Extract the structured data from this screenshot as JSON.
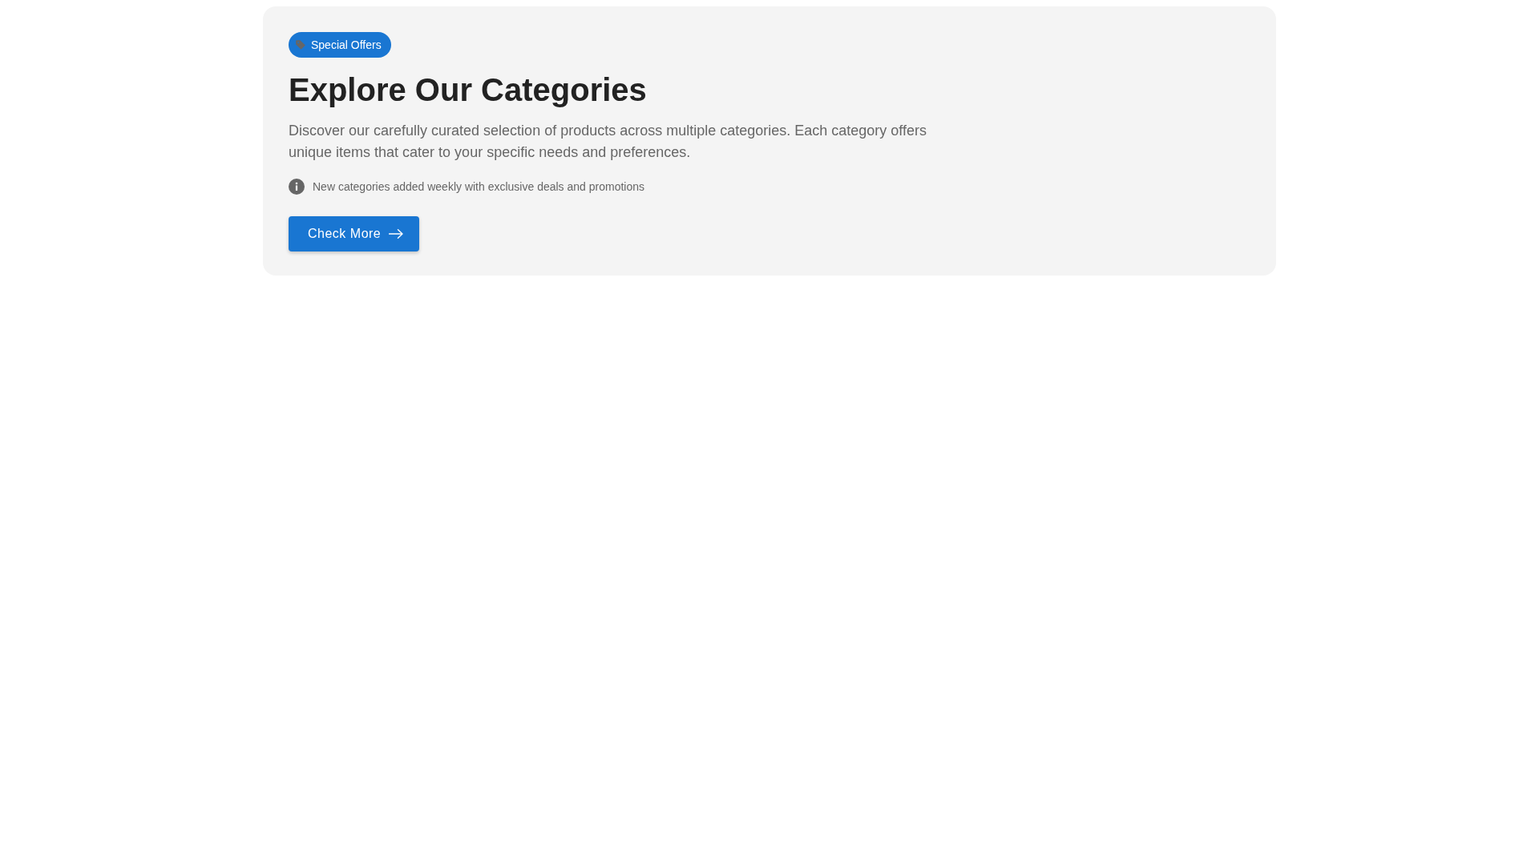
{
  "badge": {
    "label": "Special Offers"
  },
  "heading": "Explore Our Categories",
  "description": "Discover our carefully curated selection of products across multiple categories. Each category offers unique items that cater to your specific needs and preferences.",
  "note": {
    "text": "New categories added weekly with exclusive deals and promotions"
  },
  "button": {
    "label": "Check More"
  }
}
